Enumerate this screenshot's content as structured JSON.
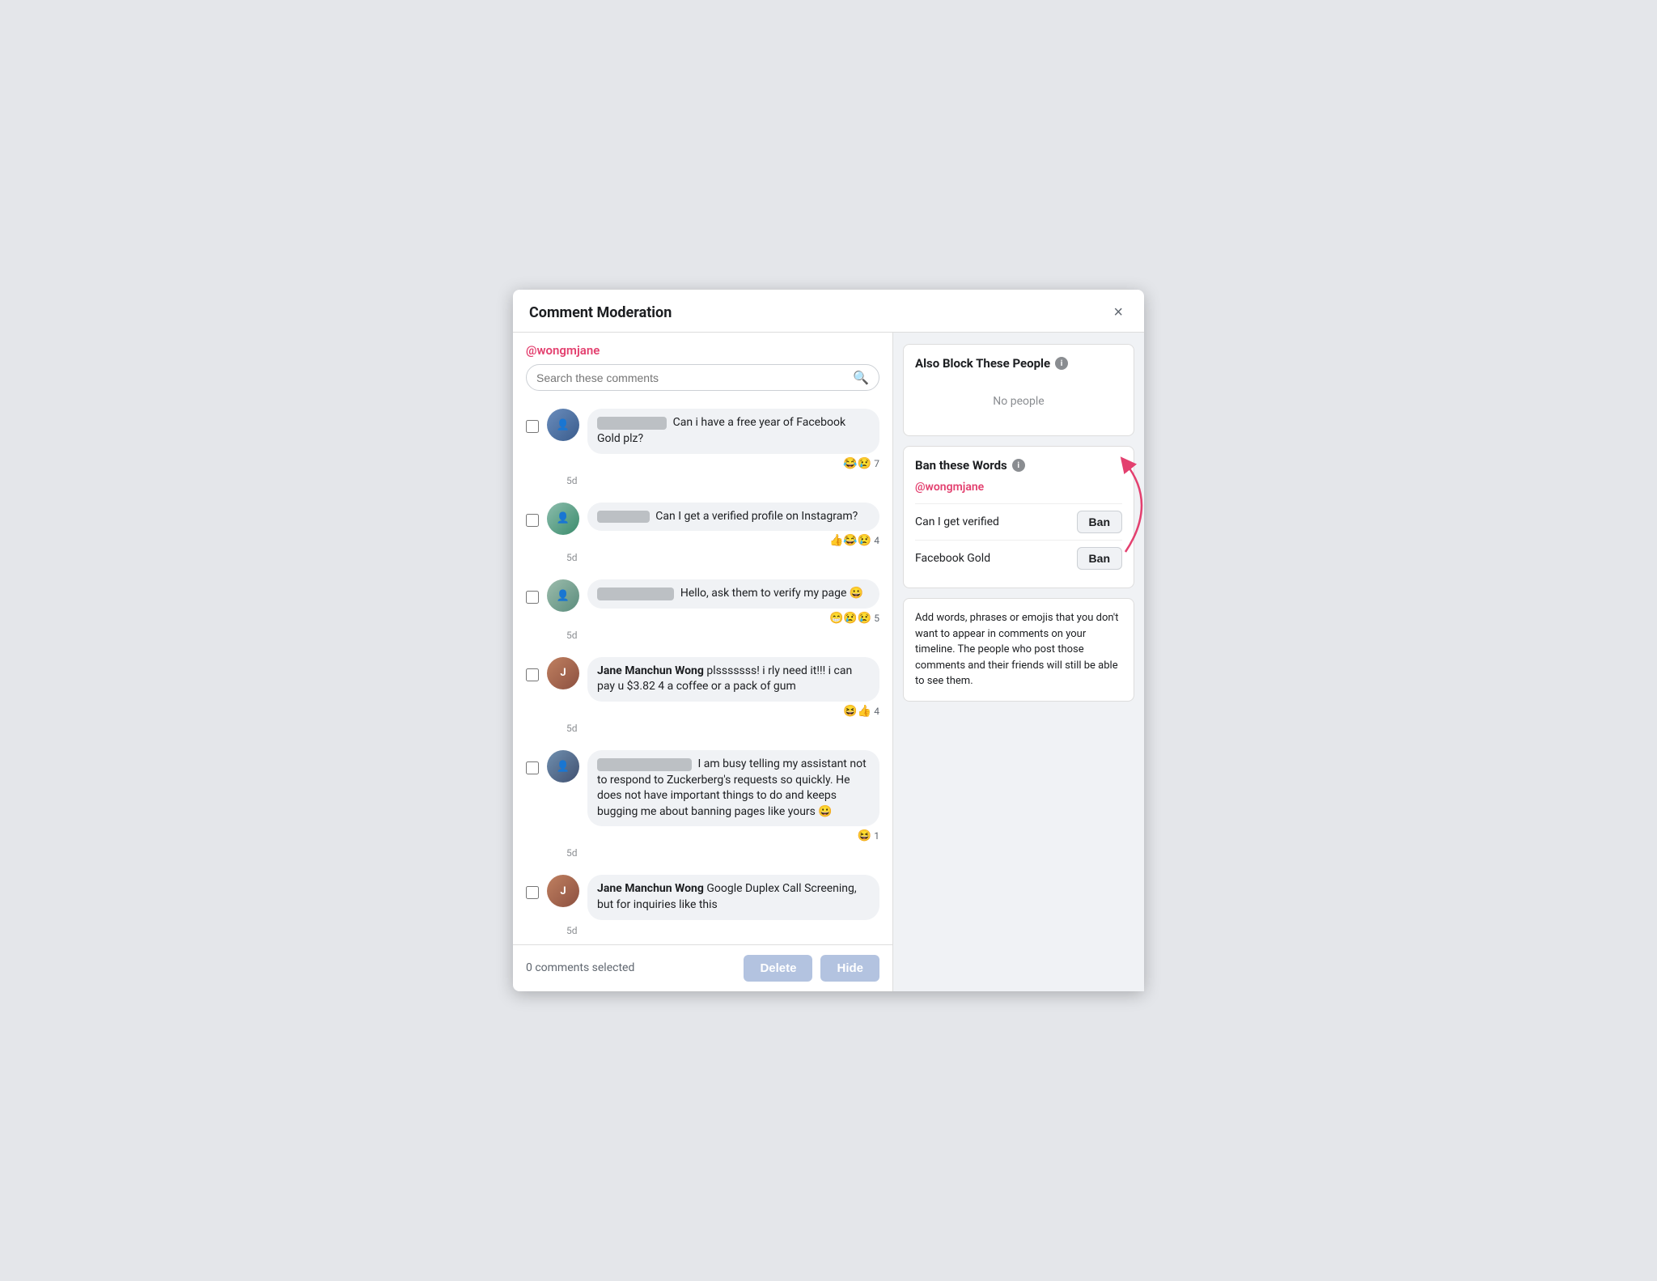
{
  "modal": {
    "title": "Comment Moderation",
    "close_label": "×"
  },
  "left": {
    "username": "@wongmjane",
    "search_placeholder": "Search these comments",
    "comments": [
      {
        "id": 1,
        "author_anon": true,
        "author_name": "████ ████",
        "text": "Can i have a free year of Facebook Gold plz?",
        "reactions": "😂😢",
        "reaction_count": "7",
        "timestamp": "5d"
      },
      {
        "id": 2,
        "author_anon": true,
        "author_name": "██ ██ ██,",
        "text": "Can I get a verified profile on Instagram?",
        "reactions": "👍😂😢",
        "reaction_count": "4",
        "timestamp": "5d"
      },
      {
        "id": 3,
        "author_anon": true,
        "author_name": "█████ █████",
        "text": "Hello, ask them to verify my page 😀",
        "reactions": "😁😢😢",
        "reaction_count": "5",
        "timestamp": "5d"
      },
      {
        "id": 4,
        "author_anon": false,
        "author_name": "Jane Manchun Wong",
        "text": "plsssssss! i rly need it!!! i can pay u $3.82 4 a coffee or a pack of gum",
        "reactions": "😆👍",
        "reaction_count": "4",
        "timestamp": "5d"
      },
      {
        "id": 5,
        "author_anon": true,
        "author_name": "████ ████ ████",
        "text": "I am busy telling my assistant not to respond to Zuckerberg's requests so quickly. He does not have important things to do and keeps bugging me about banning pages like yours 😀",
        "reactions": "😆",
        "reaction_count": "1",
        "timestamp": "5d"
      },
      {
        "id": 6,
        "author_anon": false,
        "author_name": "Jane Manchun Wong",
        "text": "Google Duplex Call Screening, but for inquiries like this",
        "reactions": "",
        "reaction_count": "",
        "timestamp": "5d"
      }
    ],
    "footer": {
      "count_label": "0 comments selected",
      "delete_label": "Delete",
      "hide_label": "Hide"
    }
  },
  "right": {
    "also_block": {
      "title": "Also Block These People",
      "no_people": "No people"
    },
    "ban_words": {
      "title": "Ban these Words",
      "username": "@wongmjane",
      "words": [
        {
          "label": "Can I get verified",
          "btn": "Ban"
        },
        {
          "label": "Facebook Gold",
          "btn": "Ban"
        }
      ]
    },
    "tooltip": {
      "text": "Add words, phrases or emojis that you don't want to appear in comments on your timeline. The people who post those comments and their friends will still be able to see them."
    }
  }
}
